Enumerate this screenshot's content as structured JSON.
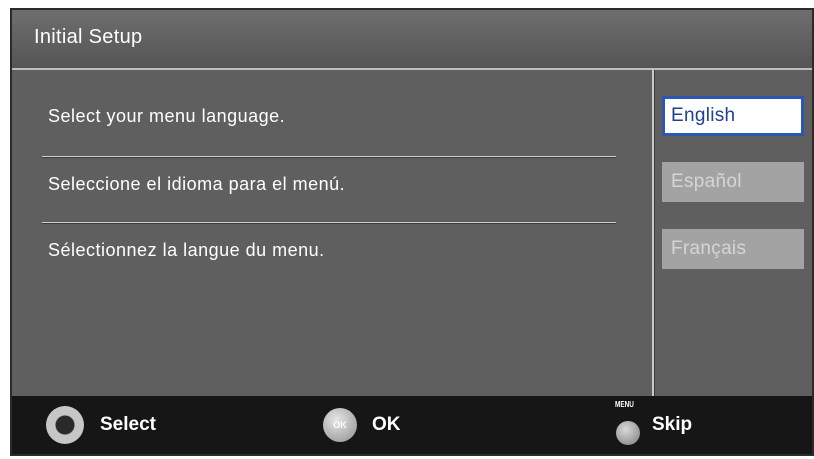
{
  "window": {
    "title": "Initial Setup"
  },
  "messages": [
    "Select your menu language.",
    "Seleccione el idioma para el menú.",
    "Sélectionnez la langue du menu."
  ],
  "languages": {
    "options": [
      "English",
      "Español",
      "Français"
    ],
    "selected": "English"
  },
  "footer": {
    "select_label": "Select",
    "ok_icon_text": "OK",
    "ok_label": "OK",
    "menu_caption": "MENU",
    "skip_label": "Skip",
    "icons": [
      "dpad-icon",
      "ok-button-icon",
      "menu-button-icon"
    ]
  },
  "colors": {
    "screen_bg": "#5f5f5f",
    "footer_bg": "#161616",
    "selected_border": "#2c56b3",
    "selected_text": "#1f3f8f",
    "unselected_bg": "#a3a3a3"
  }
}
